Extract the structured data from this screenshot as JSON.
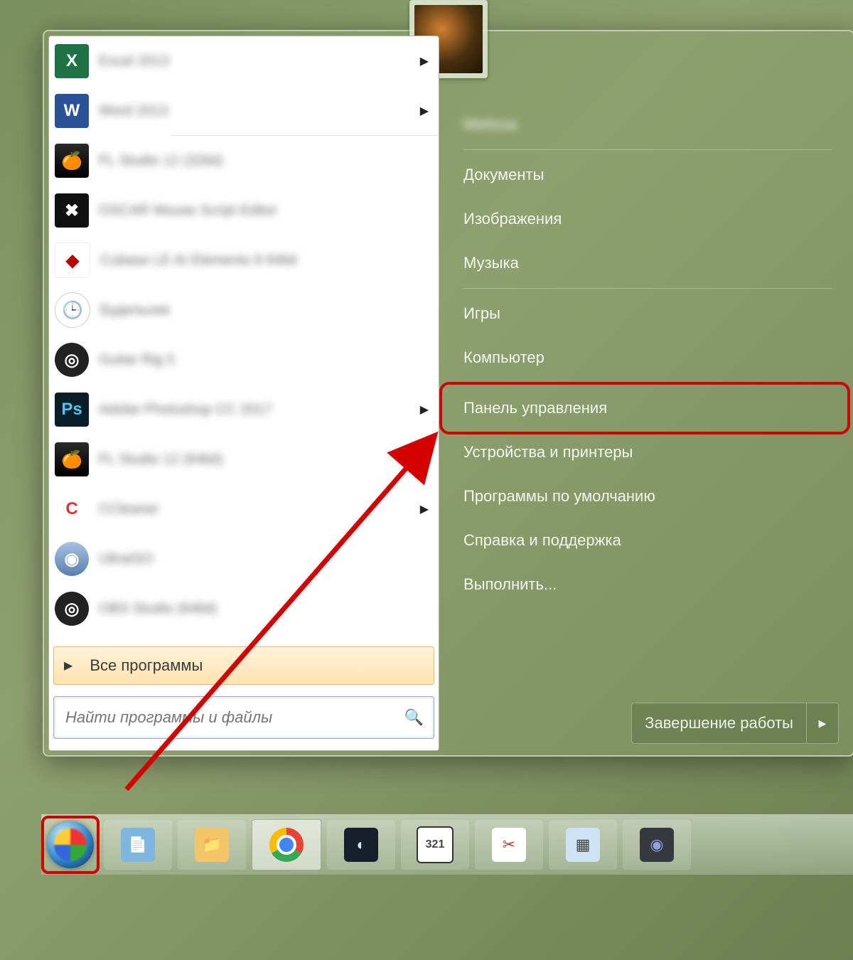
{
  "programs": [
    {
      "label": "Excel 2013",
      "icon": "excel",
      "arrow": true,
      "sep": false
    },
    {
      "label": "Word 2013",
      "icon": "word",
      "arrow": true,
      "sep": true
    },
    {
      "label": "FL Studio 12 (32bit)",
      "icon": "fl",
      "arrow": false,
      "sep": false
    },
    {
      "label": "OSCAR Mouse Script Editor",
      "icon": "osc",
      "arrow": false,
      "sep": false
    },
    {
      "label": "Cubase LE AI Elements 8 64bit",
      "icon": "cub",
      "arrow": false,
      "sep": false
    },
    {
      "label": "Будильник",
      "icon": "clock",
      "arrow": false,
      "sep": false
    },
    {
      "label": "Guitar Rig 5",
      "icon": "guitar",
      "arrow": false,
      "sep": false
    },
    {
      "label": "Adobe Photoshop CC 2017",
      "icon": "ps",
      "arrow": true,
      "sep": false
    },
    {
      "label": "FL Studio 12 (64bit)",
      "icon": "fl2",
      "arrow": false,
      "sep": false
    },
    {
      "label": "CCleaner",
      "icon": "cc",
      "arrow": true,
      "sep": false
    },
    {
      "label": "UltraISO",
      "icon": "iso",
      "arrow": false,
      "sep": false
    },
    {
      "label": "OBS Studio (64bit)",
      "icon": "obs",
      "arrow": false,
      "sep": false
    }
  ],
  "all_programs_label": "Все программы",
  "search_placeholder": "Найти программы и файлы",
  "right": {
    "username": "Melissa",
    "items": [
      "Документы",
      "Изображения",
      "Музыка",
      "Игры",
      "Компьютер",
      "Панель управления",
      "Устройства и принтеры",
      "Программы по умолчанию",
      "Справка и поддержка",
      "Выполнить..."
    ]
  },
  "shutdown_label": "Завершение работы",
  "taskbar_icons": [
    "notepad",
    "explorer",
    "chrome",
    "steam",
    "mpc",
    "snip",
    "calc",
    "discord"
  ],
  "highlighted_right_index": 5,
  "annotation_color": "#d40000"
}
